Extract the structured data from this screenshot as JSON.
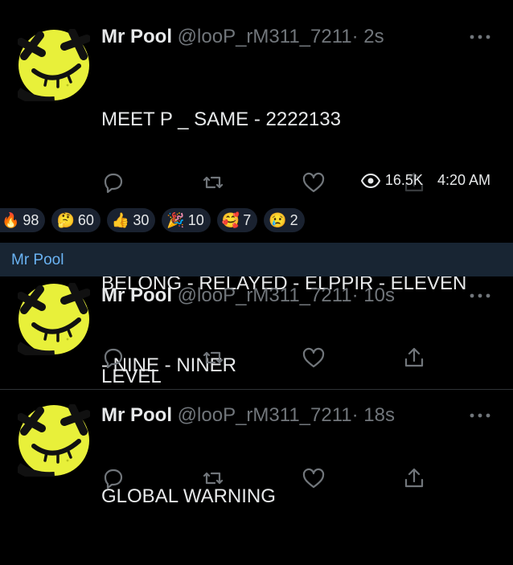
{
  "tweets": [
    {
      "name": "Mr Pool",
      "handle": "@looP_rM311_7211",
      "time": "· 2s",
      "lines": [
        "MEET P _ SAME - 2222133",
        "",
        "BELONG - RELAYED - ELPPIR - ELEVEN",
        "- NINE - NINER"
      ],
      "views": "16.5K",
      "clock": "4:20 AM"
    },
    {
      "name": "Mr Pool",
      "handle": "@looP_rM311_7211",
      "time": "· 10s",
      "lines": [
        "LEVEL"
      ]
    },
    {
      "name": "Mr Pool",
      "handle": "@looP_rM311_7211",
      "time": "· 18s",
      "lines": [
        "GLOBAL WARNING"
      ]
    }
  ],
  "reactions": [
    {
      "emoji": "🔥",
      "count": "98"
    },
    {
      "emoji": "🤔",
      "count": "60"
    },
    {
      "emoji": "👍",
      "count": "30"
    },
    {
      "emoji": "🎉",
      "count": "10"
    },
    {
      "emoji": "🥰",
      "count": "7"
    },
    {
      "emoji": "😢",
      "count": "2"
    }
  ],
  "sender": "Mr Pool",
  "colors": {
    "accent": "#6ab3f3",
    "avatar": "#e8f03a",
    "muted": "#71767b",
    "bar": "#182533",
    "chip": "#1a2230"
  },
  "icons": [
    "reply-icon",
    "retweet-icon",
    "like-icon",
    "share-icon",
    "views-icon",
    "more-icon"
  ]
}
